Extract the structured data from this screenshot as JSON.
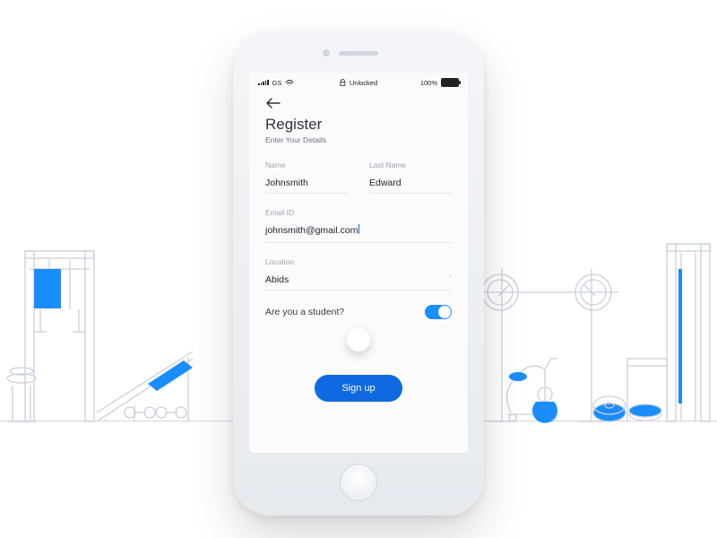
{
  "statusbar": {
    "carrier": "GS",
    "lock_label": "Unlocked",
    "battery_pct": "100%"
  },
  "header": {
    "title": "Register",
    "subtitle": "Enter Your Details"
  },
  "fields": {
    "name": {
      "label": "Name",
      "value": "Johnsmith"
    },
    "lastname": {
      "label": "Last Name",
      "value": "Edward"
    },
    "email": {
      "label": "Email ID",
      "value": "johnsmith@gmail.com"
    },
    "location": {
      "label": "Location",
      "value": "Abids"
    }
  },
  "student": {
    "question": "Are you a student?",
    "enabled": true
  },
  "cta": {
    "signup": "Sign up"
  },
  "colors": {
    "accent": "#1069e0",
    "toggle": "#1a8dff"
  }
}
